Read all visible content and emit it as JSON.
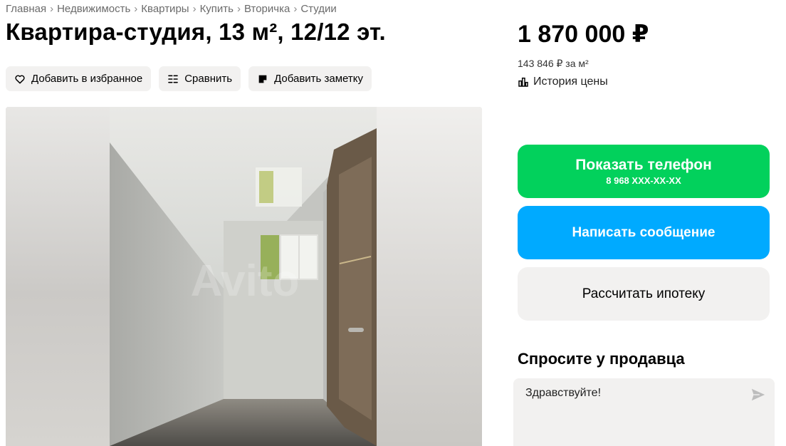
{
  "breadcrumb": {
    "items": [
      "Главная",
      "Недвижимость",
      "Квартиры",
      "Купить",
      "Вторичка",
      "Студии"
    ],
    "separator": "›"
  },
  "listing": {
    "title": "Квартира-студия, 13 м², 12/12 эт.",
    "actions": {
      "favorite_label": "Добавить в избранное",
      "compare_label": "Сравнить",
      "note_label": "Добавить заметку"
    },
    "gallery": {
      "watermark": "Avito"
    }
  },
  "sidebar": {
    "price": "1 870 000 ₽",
    "price_per_m2": "143 846 ₽ за м²",
    "price_history_label": "История цены",
    "phone_button": {
      "label": "Показать телефон",
      "number": "8 968 XXX-XX-XX",
      "color": "#02d15c"
    },
    "message_button": {
      "label": "Написать сообщение",
      "color": "#00aaff"
    },
    "mortgage_button": {
      "label": "Рассчитать ипотеку"
    },
    "ask_seller": {
      "title": "Спросите у продавца",
      "message_value": "Здравствуйте!"
    }
  },
  "icons": [
    "heart-icon",
    "compare-icon",
    "note-icon",
    "chart-icon",
    "send-icon"
  ]
}
